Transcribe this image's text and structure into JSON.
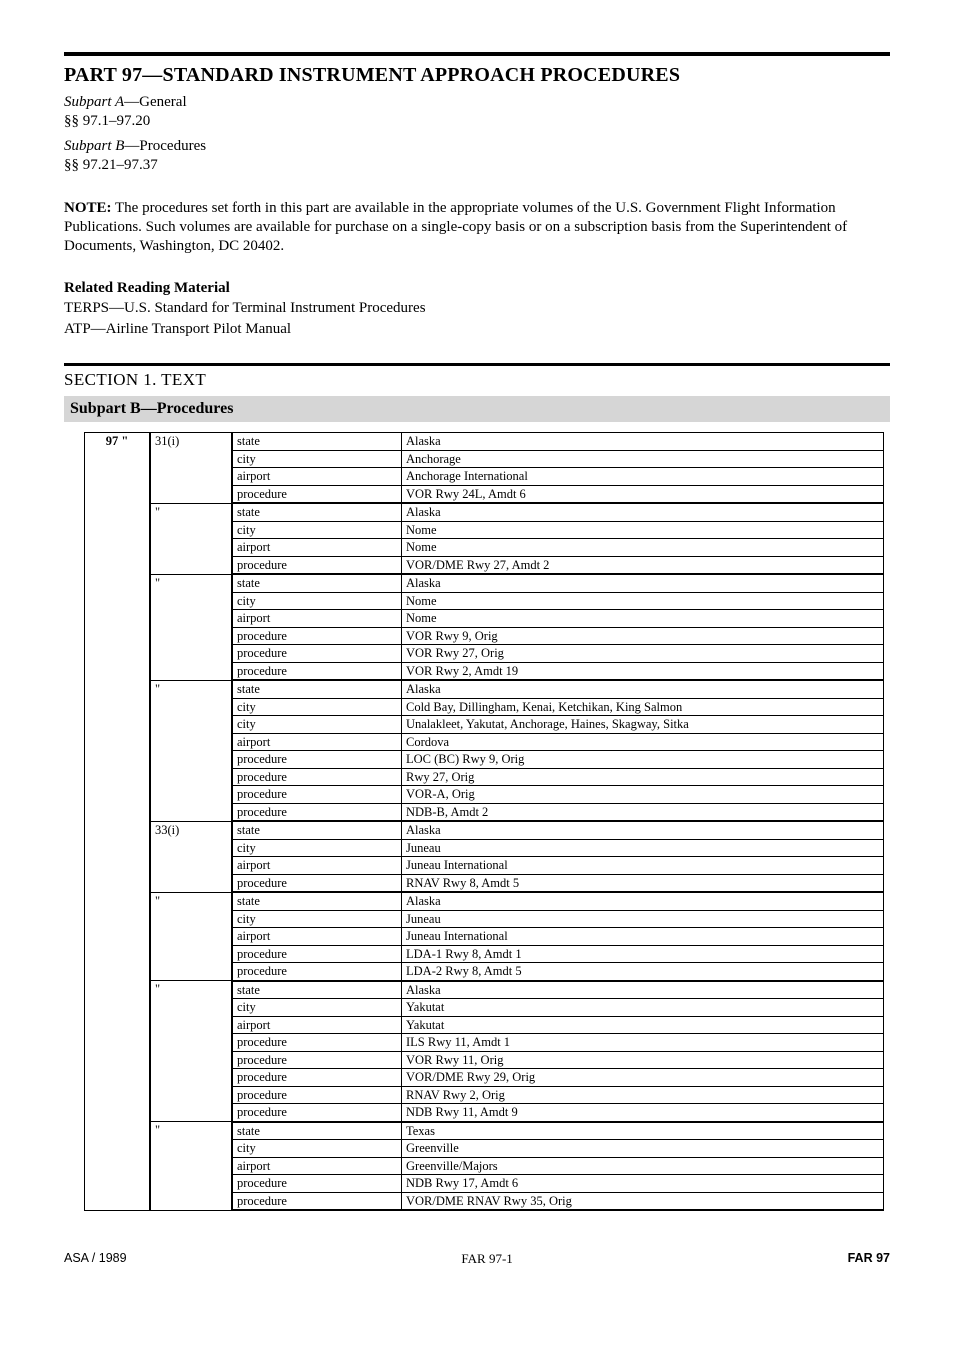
{
  "header": {
    "title": "PART 97—STANDARD INSTRUMENT APPROACH PROCEDURES",
    "sub1_a": "Subpart A",
    "sub1_b": "—General",
    "sub1_c": "§§ 97.1–97.20",
    "sub2_a": "Subpart B",
    "sub2_b": "—Procedures",
    "sub2_c": "§§ 97.21–97.37"
  },
  "note": {
    "label": "NOTE:",
    "text": " The procedures set forth in this part are available in the appropriate volumes of the U.S. Government Flight Information Publications. Such volumes are available for purchase on a single-copy basis or on a subscription basis from the Superintendent of Documents, Washington, DC 20402."
  },
  "related": {
    "label": "Related Reading Material",
    "line1": "TERPS—U.S. Standard for Terminal Instrument Procedures",
    "line2": "ATP—Airline Transport Pilot Manual"
  },
  "section": {
    "heading": "SECTION 1. TEXT",
    "band": "Subpart B—Procedures"
  },
  "table": {
    "col0": "97  \"",
    "groups": [
      {
        "col1": "31(i)",
        "rows": [
          {
            "k": "state",
            "v": "Alaska"
          },
          {
            "k": "city",
            "v": "Anchorage"
          },
          {
            "k": "airport",
            "v": "Anchorage International"
          },
          {
            "k": "procedure",
            "v": "VOR Rwy 24L, Amdt 6"
          }
        ]
      },
      {
        "col1": "\"",
        "rows": [
          {
            "k": "state",
            "v": "Alaska"
          },
          {
            "k": "city",
            "v": "Nome"
          },
          {
            "k": "airport",
            "v": "Nome"
          },
          {
            "k": "procedure",
            "v": "VOR/DME Rwy 27, Amdt 2"
          }
        ]
      },
      {
        "col1": "\"",
        "rows": [
          {
            "k": "state",
            "v": "Alaska"
          },
          {
            "k": "city",
            "v": "Nome"
          },
          {
            "k": "airport",
            "v": "Nome"
          },
          {
            "k": "procedure",
            "v": "VOR Rwy 9, Orig"
          },
          {
            "k": "procedure",
            "v": "VOR Rwy 27, Orig"
          },
          {
            "k": "procedure",
            "v": "VOR Rwy 2, Amdt 19"
          }
        ]
      },
      {
        "col1": "\"",
        "rows": [
          {
            "k": "state",
            "v": "Alaska"
          },
          {
            "k": "city",
            "v": "Cold Bay, Dillingham, Kenai, Ketchikan, King Salmon"
          },
          {
            "k": "city",
            "v": "Unalakleet, Yakutat, Anchorage, Haines, Skagway, Sitka"
          },
          {
            "k": "airport",
            "v": "Cordova"
          },
          {
            "k": "procedure",
            "v": "LOC (BC) Rwy 9, Orig"
          },
          {
            "k": "procedure",
            "v": "Rwy 27, Orig"
          },
          {
            "k": "procedure",
            "v": "VOR-A, Orig"
          },
          {
            "k": "procedure",
            "v": "NDB-B, Amdt 2"
          }
        ]
      },
      {
        "col1": "33(i)",
        "rows": [
          {
            "k": "state",
            "v": "Alaska"
          },
          {
            "k": "city",
            "v": "Juneau"
          },
          {
            "k": "airport",
            "v": "Juneau International"
          },
          {
            "k": "procedure",
            "v": "RNAV Rwy 8, Amdt 5"
          }
        ]
      },
      {
        "col1": "\"",
        "rows": [
          {
            "k": "state",
            "v": "Alaska"
          },
          {
            "k": "city",
            "v": "Juneau"
          },
          {
            "k": "airport",
            "v": "Juneau International"
          },
          {
            "k": "procedure",
            "v": "LDA-1 Rwy 8, Amdt 1"
          },
          {
            "k": "procedure",
            "v": "LDA-2 Rwy 8, Amdt 5"
          }
        ]
      },
      {
        "col1": "\"",
        "rows": [
          {
            "k": "state",
            "v": "Alaska"
          },
          {
            "k": "city",
            "v": "Yakutat"
          },
          {
            "k": "airport",
            "v": "Yakutat"
          },
          {
            "k": "procedure",
            "v": "ILS Rwy 11, Amdt 1"
          },
          {
            "k": "procedure",
            "v": "VOR Rwy 11, Orig"
          },
          {
            "k": "procedure",
            "v": "VOR/DME Rwy 29, Orig"
          },
          {
            "k": "procedure",
            "v": "RNAV Rwy 2, Orig"
          },
          {
            "k": "procedure",
            "v": "NDB Rwy 11, Amdt 9"
          }
        ]
      },
      {
        "col1": "\"",
        "rows": [
          {
            "k": "state",
            "v": "Texas"
          },
          {
            "k": "city",
            "v": "Greenville"
          },
          {
            "k": "airport",
            "v": "Greenville/Majors"
          },
          {
            "k": "procedure",
            "v": "NDB Rwy 17, Amdt 6"
          },
          {
            "k": "procedure",
            "v": "VOR/DME RNAV Rwy 35, Orig"
          }
        ]
      }
    ]
  },
  "footer": {
    "left": "ASA / 1989",
    "center": "FAR 97-1",
    "right": "FAR 97"
  }
}
